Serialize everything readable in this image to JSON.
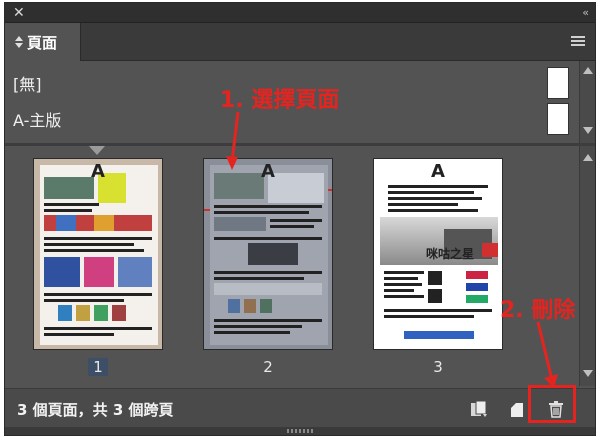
{
  "window": {
    "close_glyph": "✕",
    "collapse_glyph": "‹‹"
  },
  "tabs": [
    {
      "label": "頁面",
      "icon": "tab-arrows-icon"
    }
  ],
  "masters": [
    {
      "name": "[無]"
    },
    {
      "name": "A-主版"
    }
  ],
  "pages": [
    {
      "number": "1",
      "master_letter": "A",
      "current": true
    },
    {
      "number": "2",
      "master_letter": "A",
      "current": false
    },
    {
      "number": "3",
      "master_letter": "A",
      "current": false
    }
  ],
  "page3_headline": "咪咕之星",
  "status": {
    "summary": "3 個頁面，共 3 個跨頁"
  },
  "toolbar_icons": [
    "edit-page-size-icon",
    "new-page-icon",
    "trash-icon"
  ],
  "annotations": {
    "step1": "1. 選擇頁面",
    "step2": "2. 刪除"
  },
  "colors": {
    "panel_bg": "#535353",
    "annotation_red": "#e52420",
    "current_page_highlight": "#3d4f66"
  }
}
